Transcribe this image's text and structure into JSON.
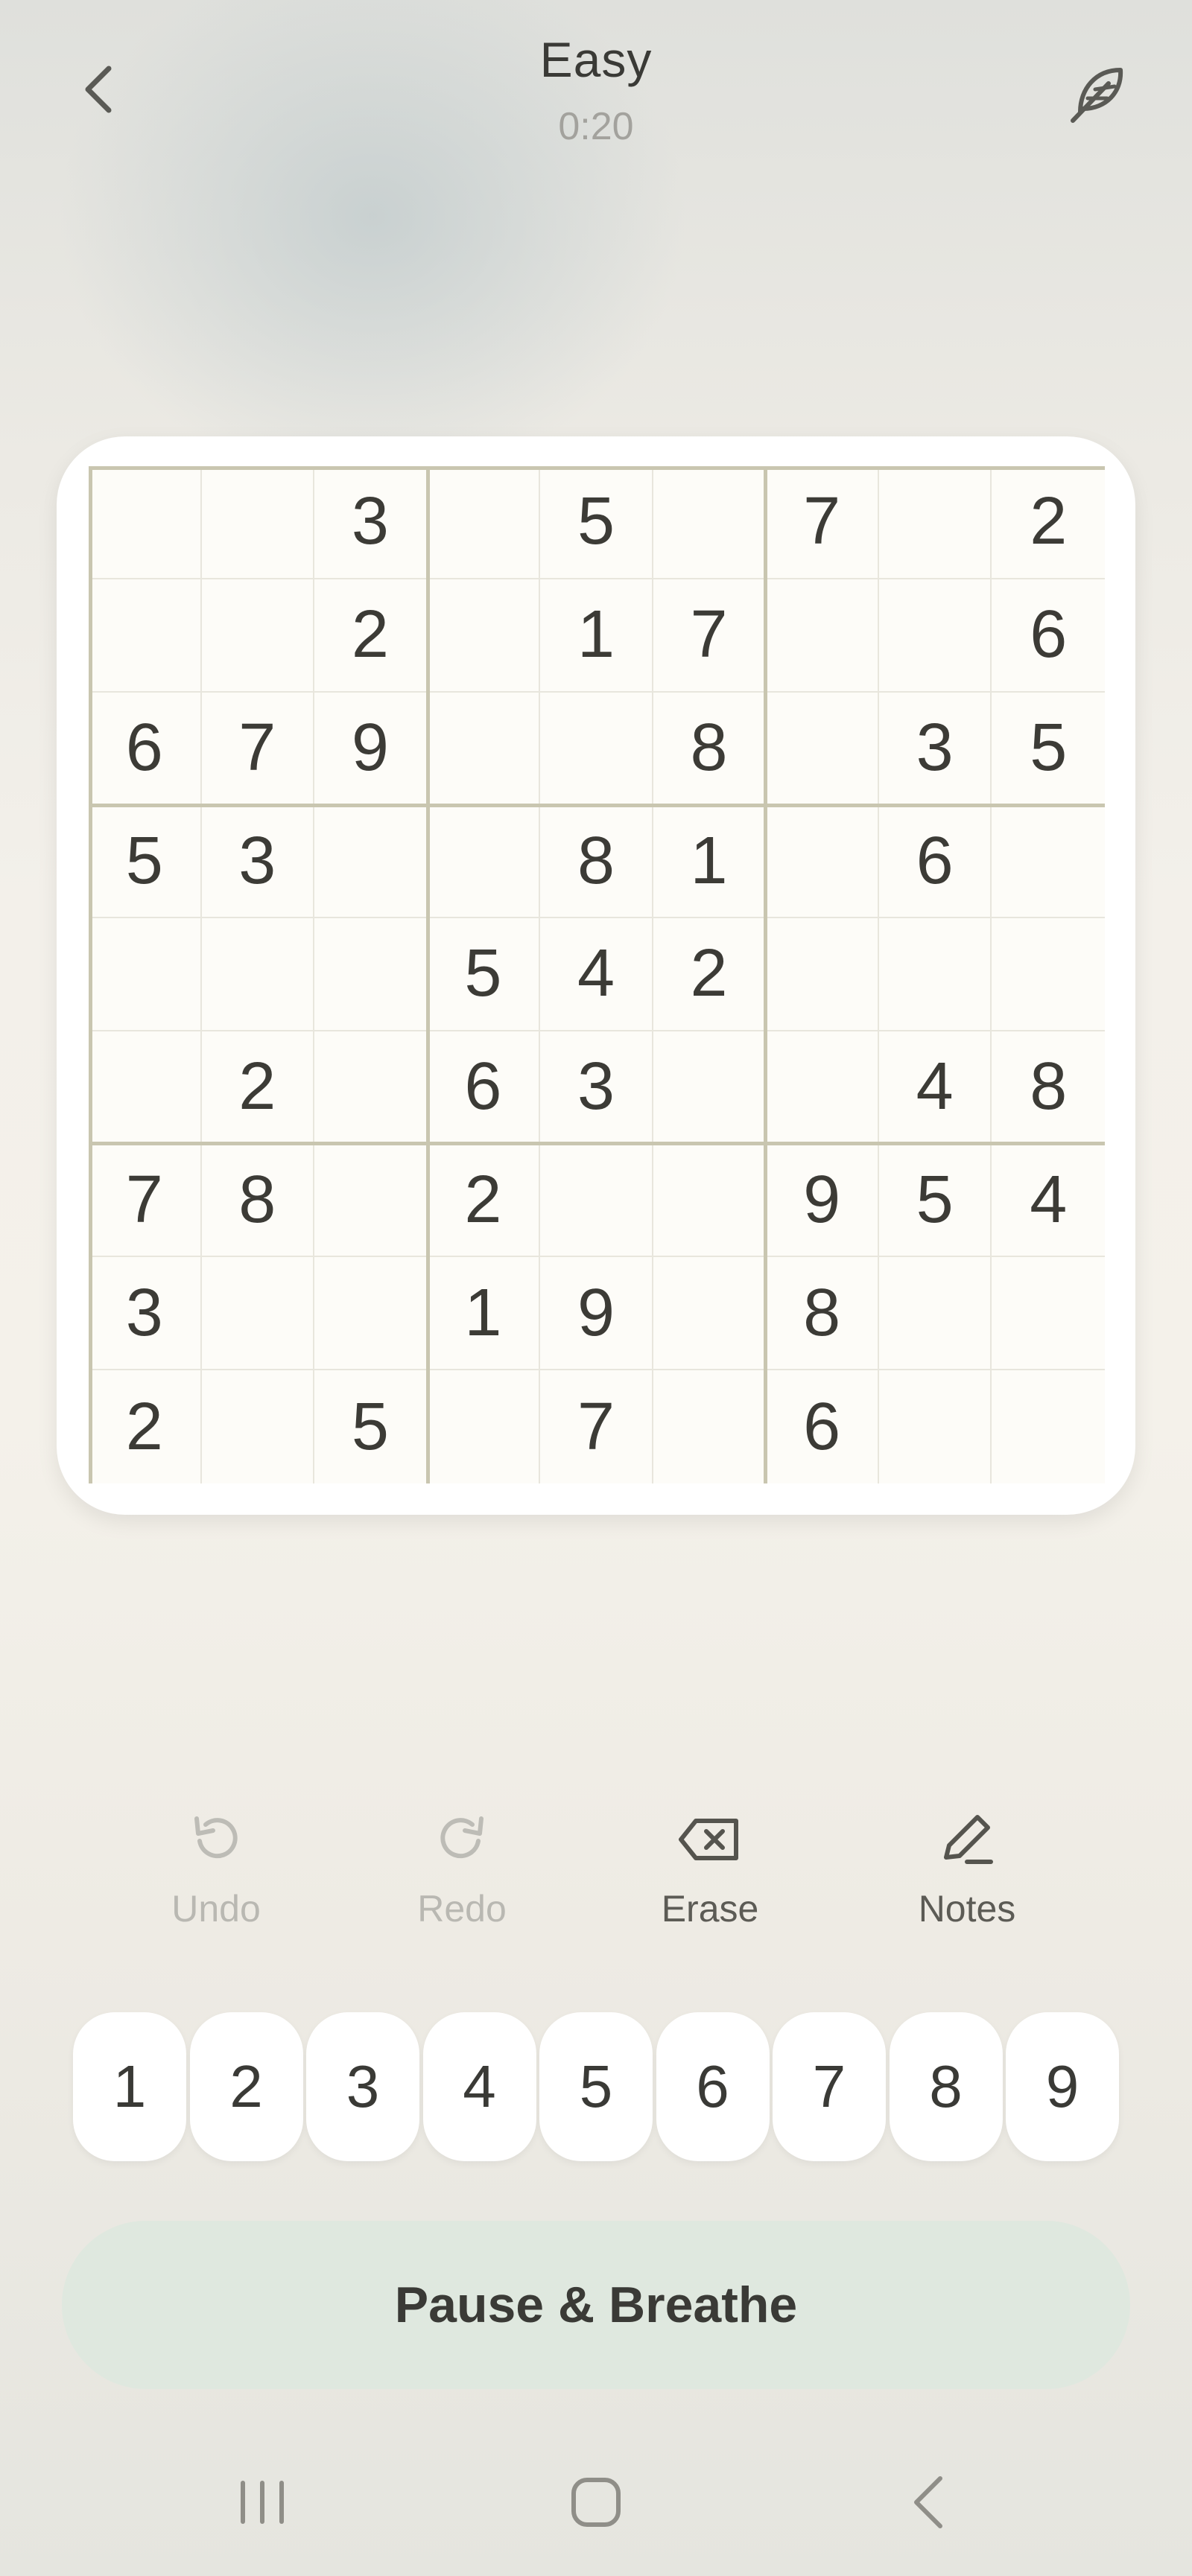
{
  "header": {
    "title": "Easy",
    "timer": "0:20",
    "back_icon": "chevron-left-icon",
    "feather_icon": "feather-icon"
  },
  "board": {
    "rows": [
      [
        "",
        "",
        "3",
        "",
        "5",
        "",
        "7",
        "",
        "2"
      ],
      [
        "",
        "",
        "2",
        "",
        "1",
        "7",
        "",
        "",
        "6"
      ],
      [
        "6",
        "7",
        "9",
        "",
        "",
        "8",
        "",
        "3",
        "5"
      ],
      [
        "5",
        "3",
        "",
        "",
        "8",
        "1",
        "",
        "6",
        ""
      ],
      [
        "",
        "",
        "",
        "5",
        "4",
        "2",
        "",
        "",
        ""
      ],
      [
        "",
        "2",
        "",
        "6",
        "3",
        "",
        "",
        "4",
        "8"
      ],
      [
        "7",
        "8",
        "",
        "2",
        "",
        "",
        "9",
        "5",
        "4"
      ],
      [
        "3",
        "",
        "",
        "1",
        "9",
        "",
        "8",
        "",
        ""
      ],
      [
        "2",
        "",
        "5",
        "",
        "7",
        "",
        "6",
        "",
        ""
      ]
    ]
  },
  "actions": {
    "undo": {
      "label": "Undo",
      "icon": "undo-icon",
      "enabled": false
    },
    "redo": {
      "label": "Redo",
      "icon": "redo-icon",
      "enabled": false
    },
    "erase": {
      "label": "Erase",
      "icon": "erase-icon",
      "enabled": true
    },
    "notes": {
      "label": "Notes",
      "icon": "pencil-icon",
      "enabled": true
    }
  },
  "numpad": [
    "1",
    "2",
    "3",
    "4",
    "5",
    "6",
    "7",
    "8",
    "9"
  ],
  "pause_button": {
    "label": "Pause & Breathe"
  },
  "system_nav": {
    "recents_icon": "recents-icon",
    "home_icon": "home-icon",
    "back_icon": "back-icon"
  },
  "colors": {
    "board_bg": "#fdfcf8",
    "box_line": "#c9c6b0",
    "cell_line": "#e8e6dd",
    "pause_bg": "#dfe8df",
    "digit": "#3c3b36",
    "disabled": "#b9b8b2"
  }
}
